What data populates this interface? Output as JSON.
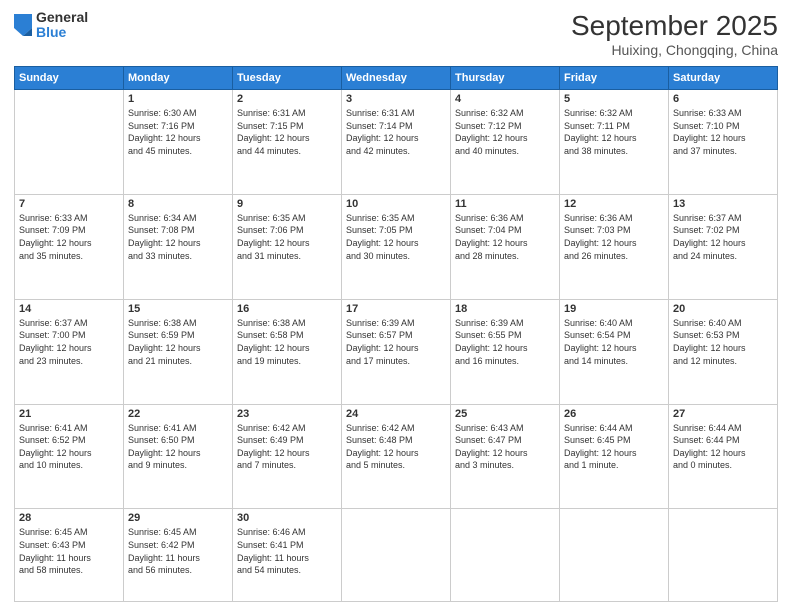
{
  "header": {
    "logo": {
      "general": "General",
      "blue": "Blue"
    },
    "title": "September 2025",
    "subtitle": "Huixing, Chongqing, China"
  },
  "weekdays": [
    "Sunday",
    "Monday",
    "Tuesday",
    "Wednesday",
    "Thursday",
    "Friday",
    "Saturday"
  ],
  "weeks": [
    [
      {
        "day": "",
        "info": ""
      },
      {
        "day": "1",
        "info": "Sunrise: 6:30 AM\nSunset: 7:16 PM\nDaylight: 12 hours\nand 45 minutes."
      },
      {
        "day": "2",
        "info": "Sunrise: 6:31 AM\nSunset: 7:15 PM\nDaylight: 12 hours\nand 44 minutes."
      },
      {
        "day": "3",
        "info": "Sunrise: 6:31 AM\nSunset: 7:14 PM\nDaylight: 12 hours\nand 42 minutes."
      },
      {
        "day": "4",
        "info": "Sunrise: 6:32 AM\nSunset: 7:12 PM\nDaylight: 12 hours\nand 40 minutes."
      },
      {
        "day": "5",
        "info": "Sunrise: 6:32 AM\nSunset: 7:11 PM\nDaylight: 12 hours\nand 38 minutes."
      },
      {
        "day": "6",
        "info": "Sunrise: 6:33 AM\nSunset: 7:10 PM\nDaylight: 12 hours\nand 37 minutes."
      }
    ],
    [
      {
        "day": "7",
        "info": "Sunrise: 6:33 AM\nSunset: 7:09 PM\nDaylight: 12 hours\nand 35 minutes."
      },
      {
        "day": "8",
        "info": "Sunrise: 6:34 AM\nSunset: 7:08 PM\nDaylight: 12 hours\nand 33 minutes."
      },
      {
        "day": "9",
        "info": "Sunrise: 6:35 AM\nSunset: 7:06 PM\nDaylight: 12 hours\nand 31 minutes."
      },
      {
        "day": "10",
        "info": "Sunrise: 6:35 AM\nSunset: 7:05 PM\nDaylight: 12 hours\nand 30 minutes."
      },
      {
        "day": "11",
        "info": "Sunrise: 6:36 AM\nSunset: 7:04 PM\nDaylight: 12 hours\nand 28 minutes."
      },
      {
        "day": "12",
        "info": "Sunrise: 6:36 AM\nSunset: 7:03 PM\nDaylight: 12 hours\nand 26 minutes."
      },
      {
        "day": "13",
        "info": "Sunrise: 6:37 AM\nSunset: 7:02 PM\nDaylight: 12 hours\nand 24 minutes."
      }
    ],
    [
      {
        "day": "14",
        "info": "Sunrise: 6:37 AM\nSunset: 7:00 PM\nDaylight: 12 hours\nand 23 minutes."
      },
      {
        "day": "15",
        "info": "Sunrise: 6:38 AM\nSunset: 6:59 PM\nDaylight: 12 hours\nand 21 minutes."
      },
      {
        "day": "16",
        "info": "Sunrise: 6:38 AM\nSunset: 6:58 PM\nDaylight: 12 hours\nand 19 minutes."
      },
      {
        "day": "17",
        "info": "Sunrise: 6:39 AM\nSunset: 6:57 PM\nDaylight: 12 hours\nand 17 minutes."
      },
      {
        "day": "18",
        "info": "Sunrise: 6:39 AM\nSunset: 6:55 PM\nDaylight: 12 hours\nand 16 minutes."
      },
      {
        "day": "19",
        "info": "Sunrise: 6:40 AM\nSunset: 6:54 PM\nDaylight: 12 hours\nand 14 minutes."
      },
      {
        "day": "20",
        "info": "Sunrise: 6:40 AM\nSunset: 6:53 PM\nDaylight: 12 hours\nand 12 minutes."
      }
    ],
    [
      {
        "day": "21",
        "info": "Sunrise: 6:41 AM\nSunset: 6:52 PM\nDaylight: 12 hours\nand 10 minutes."
      },
      {
        "day": "22",
        "info": "Sunrise: 6:41 AM\nSunset: 6:50 PM\nDaylight: 12 hours\nand 9 minutes."
      },
      {
        "day": "23",
        "info": "Sunrise: 6:42 AM\nSunset: 6:49 PM\nDaylight: 12 hours\nand 7 minutes."
      },
      {
        "day": "24",
        "info": "Sunrise: 6:42 AM\nSunset: 6:48 PM\nDaylight: 12 hours\nand 5 minutes."
      },
      {
        "day": "25",
        "info": "Sunrise: 6:43 AM\nSunset: 6:47 PM\nDaylight: 12 hours\nand 3 minutes."
      },
      {
        "day": "26",
        "info": "Sunrise: 6:44 AM\nSunset: 6:45 PM\nDaylight: 12 hours\nand 1 minute."
      },
      {
        "day": "27",
        "info": "Sunrise: 6:44 AM\nSunset: 6:44 PM\nDaylight: 12 hours\nand 0 minutes."
      }
    ],
    [
      {
        "day": "28",
        "info": "Sunrise: 6:45 AM\nSunset: 6:43 PM\nDaylight: 11 hours\nand 58 minutes."
      },
      {
        "day": "29",
        "info": "Sunrise: 6:45 AM\nSunset: 6:42 PM\nDaylight: 11 hours\nand 56 minutes."
      },
      {
        "day": "30",
        "info": "Sunrise: 6:46 AM\nSunset: 6:41 PM\nDaylight: 11 hours\nand 54 minutes."
      },
      {
        "day": "",
        "info": ""
      },
      {
        "day": "",
        "info": ""
      },
      {
        "day": "",
        "info": ""
      },
      {
        "day": "",
        "info": ""
      }
    ]
  ]
}
